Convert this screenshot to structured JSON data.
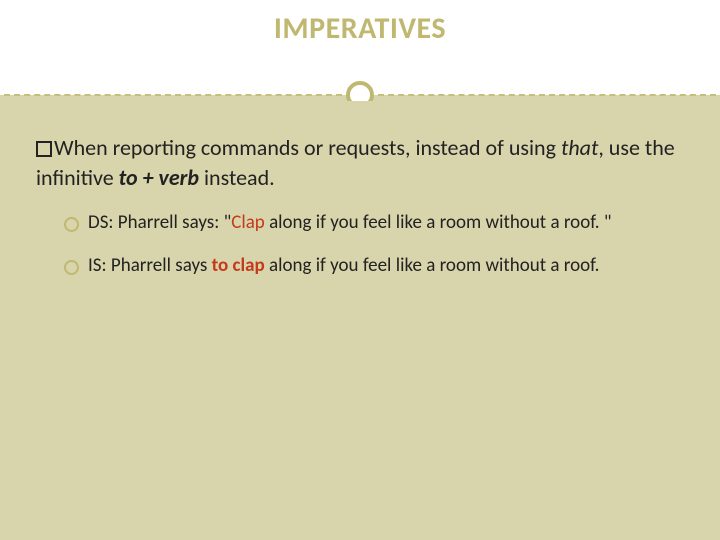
{
  "title": "IMPERATIVES",
  "lead_pre": "When reporting commands or requests, instead of using ",
  "lead_that": "that",
  "lead_mid": ", use the infinitive ",
  "lead_to_verb": "to + verb",
  "lead_post": " instead.",
  "bullets": [
    {
      "prefix": "DS: Pharrell says: \"",
      "highlight": "Clap",
      "rest": " along if you feel like a room without a roof. \""
    },
    {
      "prefix": "IS: Pharrell says ",
      "highlight": "to clap",
      "rest": " along if you feel like a room without a roof."
    }
  ]
}
